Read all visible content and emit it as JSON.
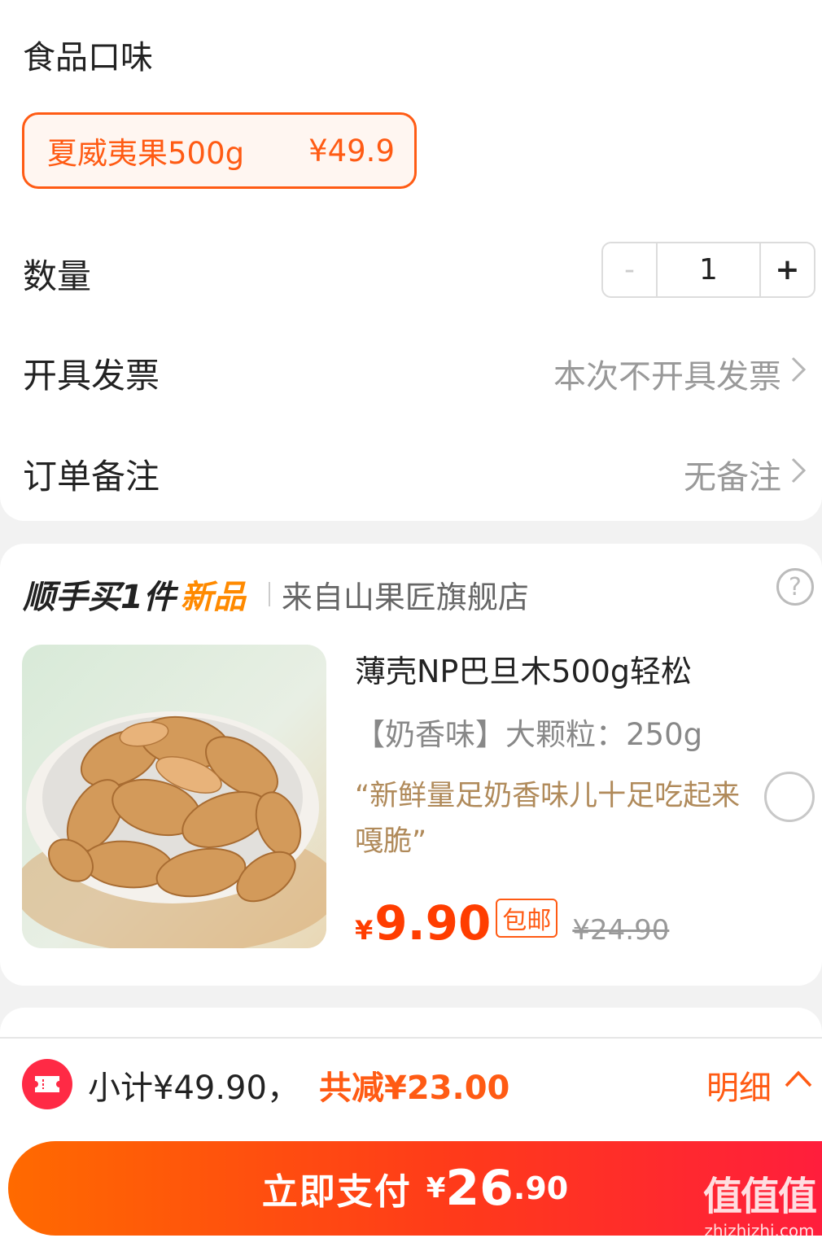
{
  "flavor": {
    "section_title": "食品口味",
    "option_name": "夏威夷果500g",
    "option_price": "¥49.9"
  },
  "quantity": {
    "label": "数量",
    "minus": "-",
    "value": "1",
    "plus": "+"
  },
  "invoice": {
    "label": "开具发票",
    "value": "本次不开具发票"
  },
  "remark": {
    "label": "订单备注",
    "value": "无备注"
  },
  "upsell": {
    "title": "顺手买1件",
    "tag": "新品",
    "shop": "来自山果匠旗舰店",
    "help": "?",
    "product": {
      "name": "薄壳NP巴旦木500g轻松",
      "spec": "【奶香味】大颗粒：250g",
      "quote": "“新鲜量足奶香味儿十足吃起来嘎脆”",
      "currency": "¥",
      "price": "9.90",
      "shipping_badge": "包邮",
      "original_price": "¥24.90"
    }
  },
  "summary": {
    "subtotal": "小计¥49.90，",
    "discount": "共减¥23.00",
    "detail": "明细"
  },
  "pay_button": {
    "label": "立即支付",
    "currency": "¥",
    "amount_int": "26",
    "amount_dec": ".90"
  },
  "watermark": {
    "logo": "值值值",
    "url": "zhizhizhi.com"
  },
  "colors": {
    "accent": "#ff5b14",
    "price_red": "#ff3d00",
    "pay_gradient_start": "#ff6a00",
    "pay_gradient_end": "#ff1e3c"
  }
}
